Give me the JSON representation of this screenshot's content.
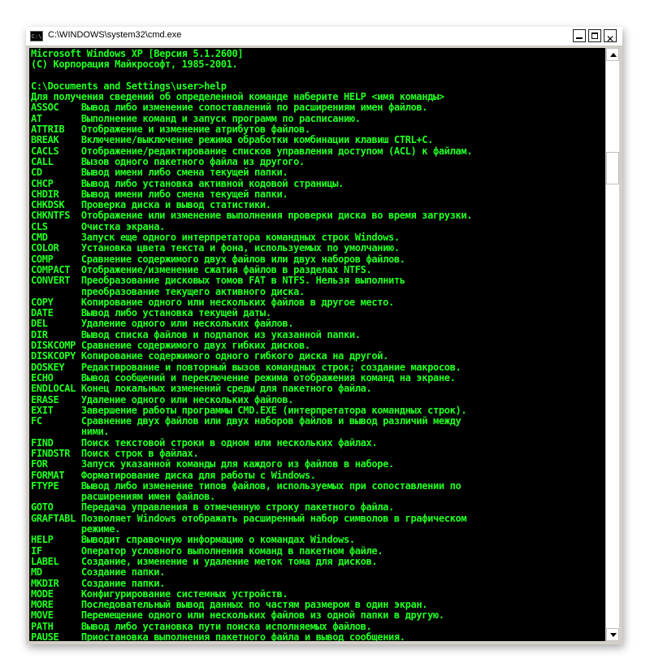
{
  "window": {
    "title": "C:\\WINDOWS\\system32\\cmd.exe",
    "icon_label": "C:\\",
    "close_glyph": "✕"
  },
  "console": {
    "lines": [
      "Microsoft Windows XP [Версия 5.1.2600]",
      "(С) Корпорация Майкрософт, 1985-2001.",
      "",
      "C:\\Documents and Settings\\user>help",
      "Для получения сведений об определенной команде наберите HELP <имя команды>",
      "ASSOC    Вывод либо изменение сопоставлений по расширениям имен файлов.",
      "AT       Выполнение команд и запуск программ по расписанию.",
      "ATTRIB   Отображение и изменение атрибутов файлов.",
      "BREAK    Включение/выключение режима обработки комбинации клавиш CTRL+C.",
      "CACLS    Отображение/редактирование списков управления доступом (ACL) к файлам.",
      "CALL     Вызов одного пакетного файла из другого.",
      "CD       Вывод имени либо смена текущей папки.",
      "CHCP     Вывод либо установка активной кодовой страницы.",
      "CHDIR    Вывод имени либо смена текущей папки.",
      "CHKDSK   Проверка диска и вывод статистики.",
      "CHKNTFS  Отображение или изменение выполнения проверки диска во время загрузки.",
      "CLS      Очистка экрана.",
      "CMD      Запуск еще одного интерпретатора командных строк Windows.",
      "COLOR    Установка цвета текста и фона, используемых по умолчанию.",
      "COMP     Сравнение содержимого двух файлов или двух наборов файлов.",
      "COMPACT  Отображение/изменение сжатия файлов в разделах NTFS.",
      "CONVERT  Преобразование дисковых томов FAT в NTFS. Нельзя выполнить",
      "         преобразование текущего активного диска.",
      "COPY     Копирование одного или нескольких файлов в другое место.",
      "DATE     Вывод либо установка текущей даты.",
      "DEL      Удаление одного или нескольких файлов.",
      "DIR      Вывод списка файлов и подпапок из указанной папки.",
      "DISKCOMP Сравнение содержимого двух гибких дисков.",
      "DISKCOPY Копирование содержимого одного гибкого диска на другой.",
      "DOSKEY   Редактирование и повторный вызов командных строк; создание макросов.",
      "ECHO     Вывод сообщений и переключение режима отображения команд на экране.",
      "ENDLOCAL Конец локальных изменений среды для пакетного файла.",
      "ERASE    Удаление одного или нескольких файлов.",
      "EXIT     Завершение работы программы CMD.EXE (интерпретатора командных строк).",
      "FC       Сравнение двух файлов или двух наборов файлов и вывод различий между",
      "         ними.",
      "FIND     Поиск текстовой строки в одном или нескольких файлах.",
      "FINDSTR  Поиск строк в файлах.",
      "FOR      Запуск указанной команды для каждого из файлов в наборе.",
      "FORMAT   Форматирование диска для работы с Windows.",
      "FTYPE    Вывод либо изменение типов файлов, используемых при сопоставлении по",
      "         расширениям имен файлов.",
      "GOTO     Передача управления в отмеченную строку пакетного файла.",
      "GRAFTABL Позволяет Windows отображать расширенный набор символов в графическом",
      "         режиме.",
      "HELP     Выводит справочную информацию о командах Windows.",
      "IF       Оператор условного выполнения команд в пакетном файле.",
      "LABEL    Создание, изменение и удаление меток тома для дисков.",
      "MD       Создание папки.",
      "MKDIR    Создание папки.",
      "MODE     Конфигурирование системных устройств.",
      "MORE     Последовательный вывод данных по частям размером в один экран.",
      "MOVE     Перемещение одного или нескольких файлов из одной папки в другую.",
      "PATH     Вывод либо установка пути поиска исполняемых файлов.",
      "PAUSE    Приостановка выполнения пакетного файла и вывод сообщения."
    ]
  },
  "colors": {
    "console_bg": "#000000",
    "console_text": "#22ff22"
  },
  "icons": {
    "app": "cmd-icon",
    "minimize": "minimize-icon",
    "maximize": "maximize-icon",
    "close": "close-icon",
    "scroll_up": "arrow-up-icon",
    "scroll_down": "arrow-down-icon"
  }
}
